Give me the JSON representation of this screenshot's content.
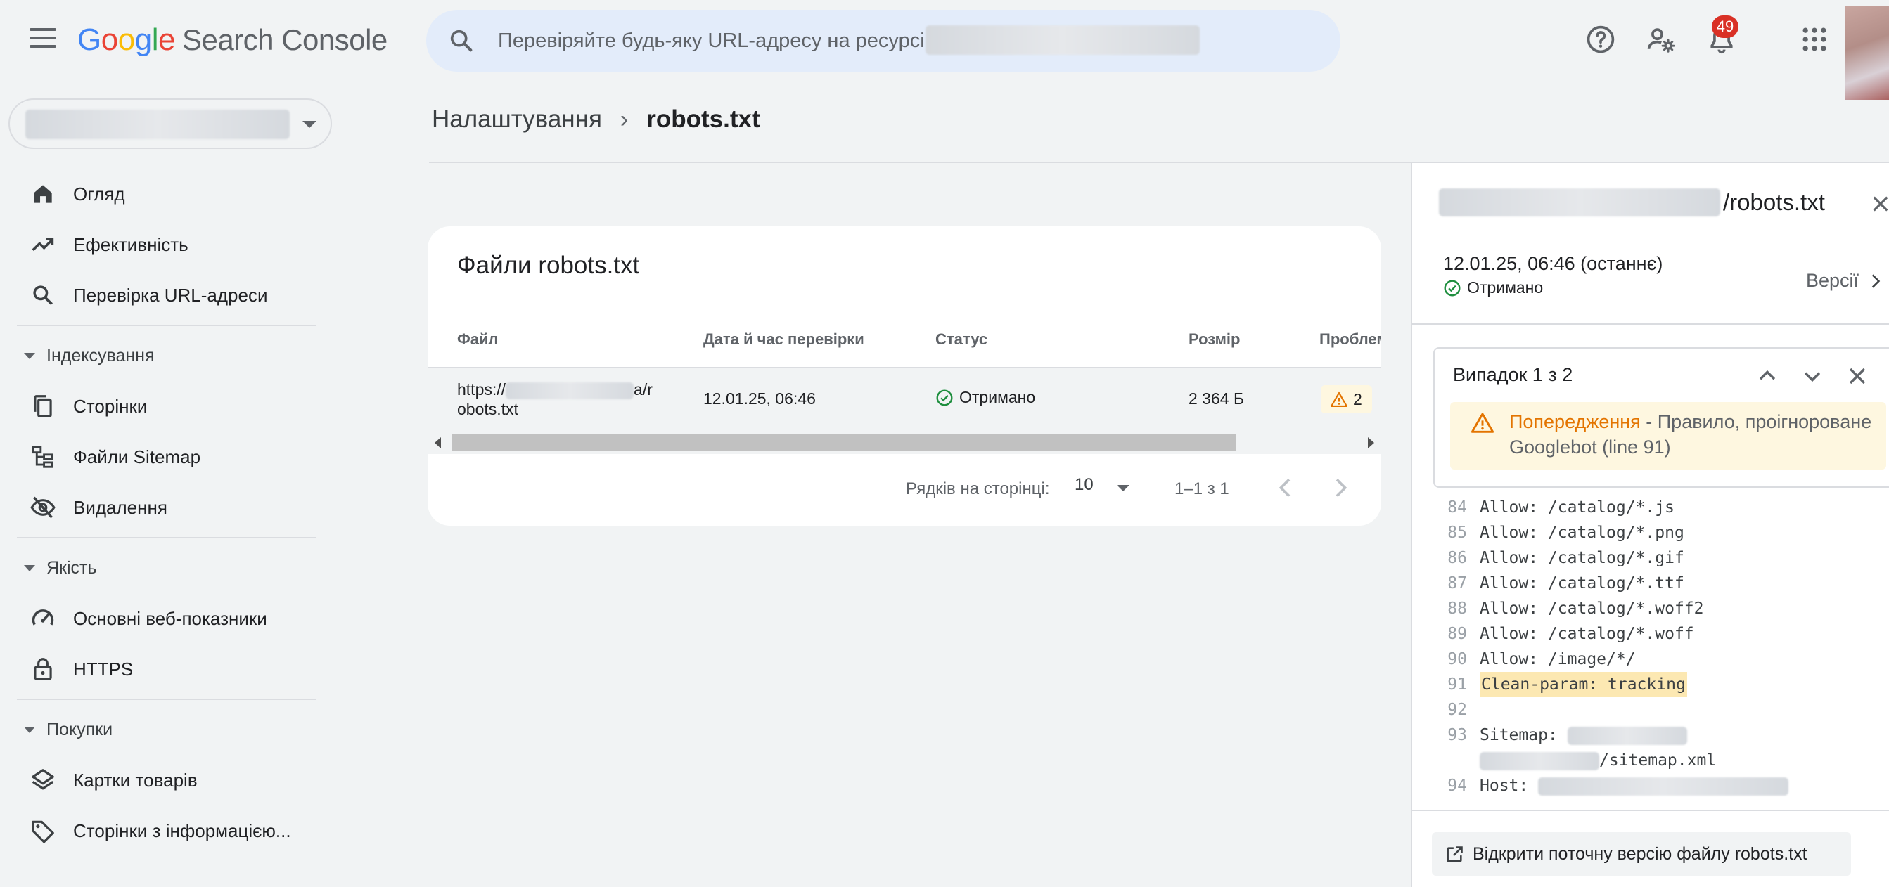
{
  "app": {
    "logo_letters": [
      "G",
      "o",
      "o",
      "g",
      "l",
      "e"
    ],
    "product": "Search Console"
  },
  "search": {
    "placeholder": "Перевіряйте будь-яку URL-адресу на ресурсі"
  },
  "header": {
    "notification_count": "49"
  },
  "sidebar": {
    "items": [
      {
        "label": "Огляд",
        "icon": "home-icon"
      },
      {
        "label": "Ефективність",
        "icon": "trending-up-icon"
      },
      {
        "label": "Перевірка URL-адреси",
        "icon": "search-icon"
      }
    ],
    "sections": [
      {
        "title": "Індексування",
        "items": [
          {
            "label": "Сторінки",
            "icon": "pages-icon"
          },
          {
            "label": "Файли Sitemap",
            "icon": "sitemap-icon"
          },
          {
            "label": "Видалення",
            "icon": "visibility-off-icon"
          }
        ]
      },
      {
        "title": "Якість",
        "items": [
          {
            "label": "Основні веб-показники",
            "icon": "speed-icon"
          },
          {
            "label": "HTTPS",
            "icon": "lock-icon"
          }
        ]
      },
      {
        "title": "Покупки",
        "items": [
          {
            "label": "Картки товарів",
            "icon": "layers-icon"
          },
          {
            "label": "Сторінки з інформацією...",
            "icon": "tag-icon"
          }
        ]
      }
    ]
  },
  "breadcrumb": {
    "parent": "Налаштування",
    "separator": "›",
    "current": "robots.txt"
  },
  "files_card": {
    "title": "Файли robots.txt",
    "columns": [
      "Файл",
      "Дата й час перевірки",
      "Статус",
      "Розмір",
      "Проблем"
    ],
    "row": {
      "url_prefix": "https://",
      "url_mid": "a/r",
      "url_suffix": "obots.txt",
      "checked": "12.01.25, 06:46",
      "status": "Отримано",
      "size": "2 364 Б",
      "issues": "2"
    },
    "pagination": {
      "rows_label": "Рядків на сторінці:",
      "rows_value": "10",
      "range": "1–1 з 1"
    }
  },
  "panel": {
    "title_suffix": "/robots.txt",
    "date": "12.01.25, 06:46 (останнє)",
    "status": "Отримано",
    "versions_label": "Версії",
    "issue": {
      "counter": "Випадок 1 з 2",
      "warning_title": "Попередження",
      "warning_text_line1": " - Правило, проігнороване",
      "warning_text_line2": "Googlebot (line 91)"
    },
    "code_lines": [
      {
        "n": "84",
        "text": "Allow: /catalog/*.js"
      },
      {
        "n": "85",
        "text": "Allow: /catalog/*.png"
      },
      {
        "n": "86",
        "text": "Allow: /catalog/*.gif"
      },
      {
        "n": "87",
        "text": "Allow: /catalog/*.ttf"
      },
      {
        "n": "88",
        "text": "Allow: /catalog/*.woff2"
      },
      {
        "n": "89",
        "text": "Allow: /catalog/*.woff"
      },
      {
        "n": "90",
        "text": "Allow: /image/*/"
      },
      {
        "n": "91",
        "text": "Clean-param: tracking"
      },
      {
        "n": "92",
        "text": ""
      },
      {
        "n": "93",
        "text": "Sitemap:"
      },
      {
        "n": "",
        "text": "/sitemap.xml"
      },
      {
        "n": "94",
        "text": "Host:"
      }
    ],
    "open_button": "Відкрити поточну версію файлу robots.txt"
  },
  "colors": {
    "background": "#f1f3f4",
    "accent_blue": "#1a73e8",
    "success_green": "#1e8e3e",
    "warning_orange": "#e37400",
    "badge_red": "#d93025",
    "highlight": "#fce8b2"
  }
}
